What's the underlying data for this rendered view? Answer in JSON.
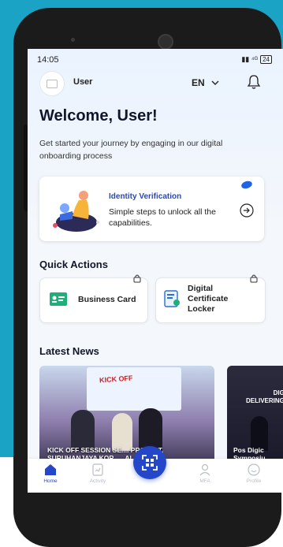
{
  "status_bar": {
    "time": "14:05",
    "battery": "24"
  },
  "header": {
    "username": "User",
    "language": "EN"
  },
  "welcome": {
    "title": "Welcome, User!",
    "subtitle": "Get started your journey by engaging in our digital onboarding process"
  },
  "identity_card": {
    "title": "Identity Verification",
    "description": "Simple steps to unlock all the capabilities."
  },
  "quick_actions": {
    "title": "Quick Actions",
    "items": [
      {
        "label": "Business Card",
        "icon": "business-card-icon",
        "locked": true
      },
      {
        "label": "Digital Certificate Locker",
        "icon": "certificate-locker-icon",
        "locked": true
      }
    ]
  },
  "latest_news": {
    "title": "Latest News",
    "items": [
      {
        "banner": "KICK OFF",
        "caption": "KICK OFF SESSION SE.... PROJECT, SURUHANJAYA KOR..... ALAY..."
      },
      {
        "banner": "DIGIT DELIVERING T",
        "caption": "Pos Digic Symposiu"
      }
    ]
  },
  "tabbar": {
    "items": [
      {
        "label": "Home",
        "icon": "home-icon",
        "active": true
      },
      {
        "label": "Activity",
        "icon": "activity-icon",
        "active": false
      },
      {
        "label": "MFA",
        "icon": "mfa-icon",
        "active": false
      },
      {
        "label": "Profile",
        "icon": "profile-icon",
        "active": false
      }
    ]
  },
  "colors": {
    "accent": "#2347c8",
    "background": "#1ba3c6"
  }
}
